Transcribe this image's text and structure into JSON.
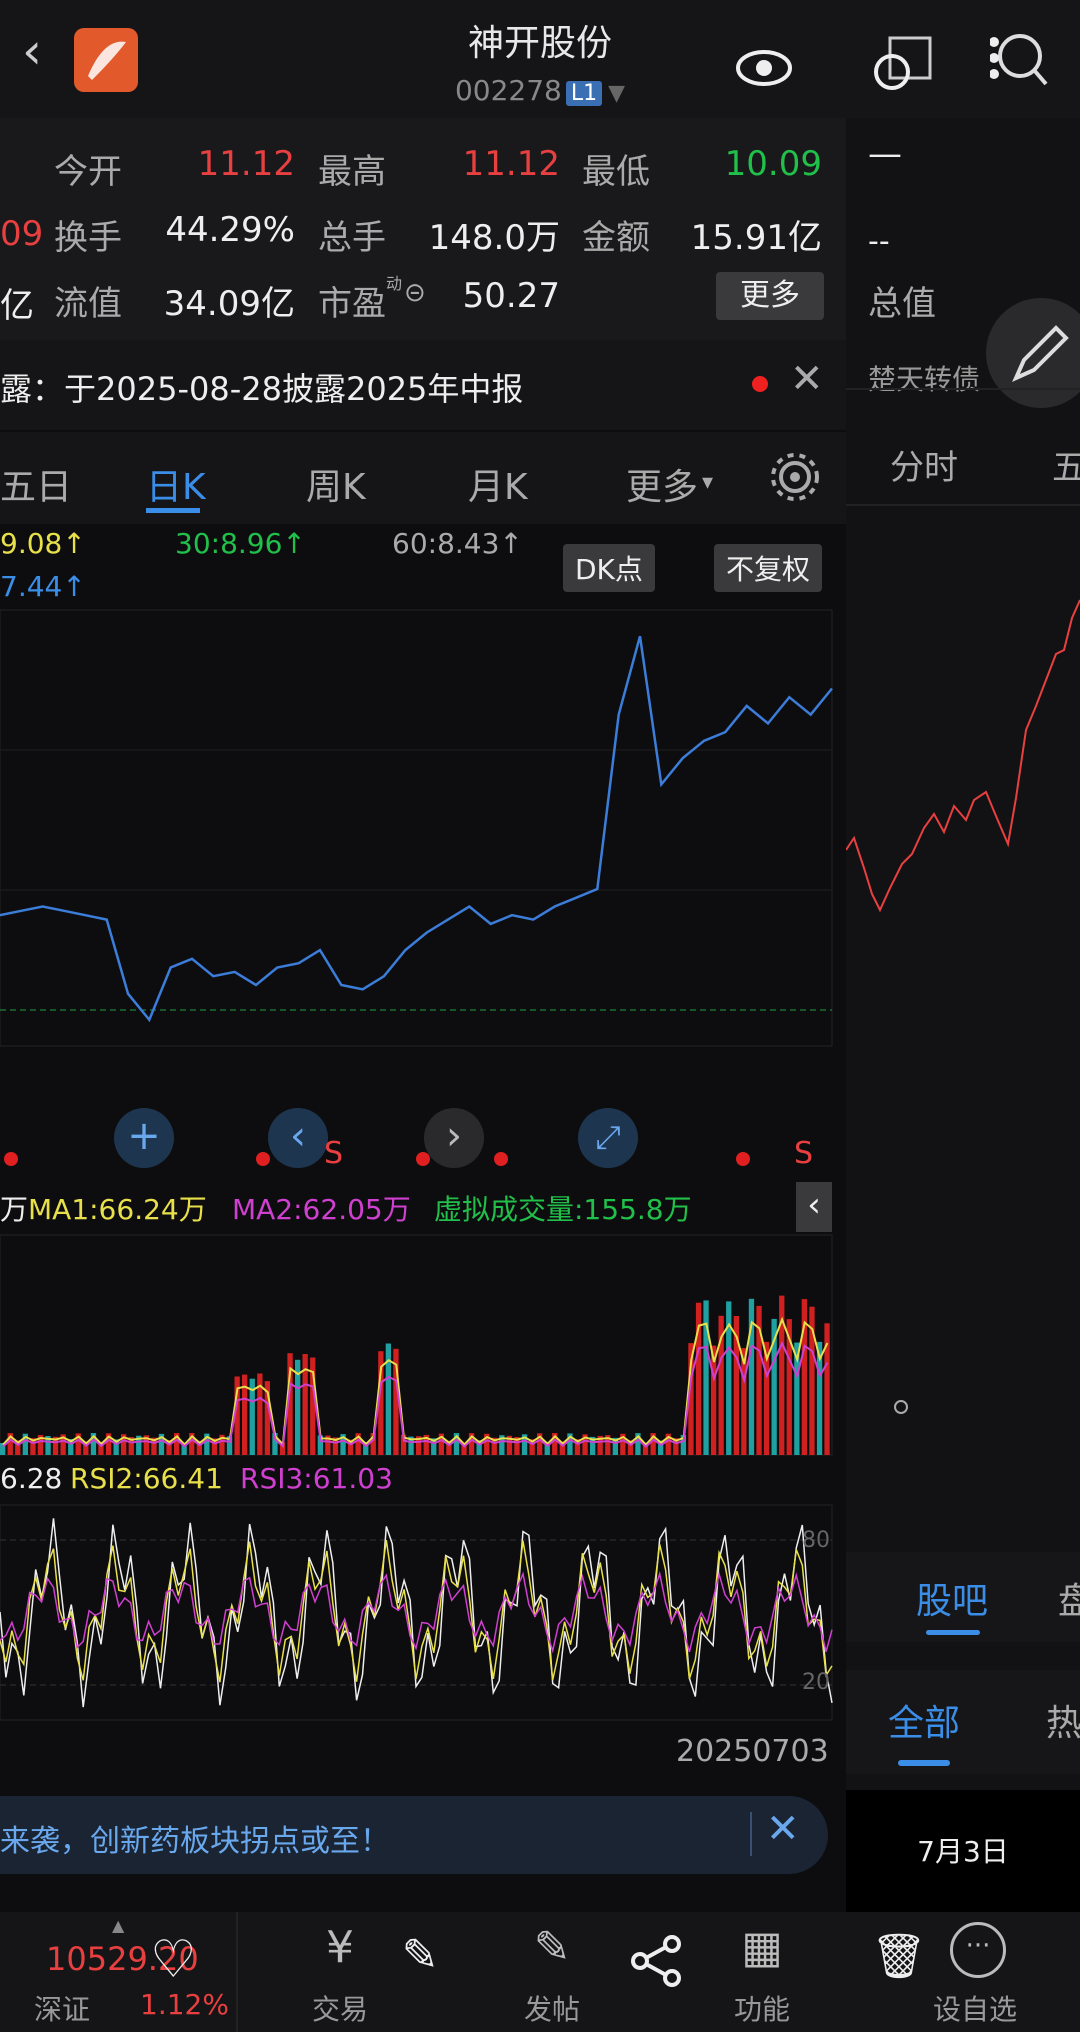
{
  "header": {
    "title": "神开股份",
    "code": "002278",
    "level": "L1"
  },
  "stats": {
    "row1": [
      {
        "label": "今开",
        "value": "11.12"
      },
      {
        "label": "最高",
        "value": "11.12"
      },
      {
        "label": "最低",
        "value": "10.09"
      }
    ],
    "row2": [
      {
        "label": "换手",
        "value": "44.29%"
      },
      {
        "label": "总手",
        "value": "148.0万"
      },
      {
        "label": "金额",
        "value": "15.91亿"
      }
    ],
    "row3": [
      {
        "label": "流值",
        "value": "34.09亿"
      },
      {
        "label": "市盈",
        "value": "50.27"
      }
    ],
    "left_partial_row2": "09",
    "left_partial_row3": "亿",
    "pe_superscript": "动",
    "more_label": "更多"
  },
  "notice": {
    "text": "露：于2025-08-28披露2025年中报"
  },
  "right_panel": {
    "dash1": "—",
    "dash2": "--",
    "total_value_label": "总值",
    "bond_label": "楚天转债",
    "minute_tab": "分时",
    "partial_tab": "五",
    "guba_tab": "股吧",
    "partial_tab2": "盘",
    "all_tab": "全部",
    "hot_tab": "热",
    "date": "7月3日"
  },
  "tabs": {
    "items": [
      "五日",
      "日K",
      "周K",
      "月K",
      "更多"
    ],
    "active": "日K"
  },
  "ma_line": {
    "ma_a": "9.08↑",
    "ma_b": "7.44↑",
    "ma30": "30:8.96↑",
    "ma60": "60:8.43↑",
    "dk_label": "DK点",
    "fq_label": "不复权"
  },
  "volume": {
    "partial": "万",
    "ma1": "MA1:66.24万",
    "ma2": "MA2:62.05万",
    "virtual": "虚拟成交量:155.8万"
  },
  "rsi": {
    "rsi1": "6.28",
    "rsi2": "RSI2:66.41",
    "rsi3": "RSI3:61.03",
    "level80": "80",
    "level20": "20"
  },
  "markers": {
    "s_label": "S"
  },
  "date_label": "20250703",
  "banner": {
    "text": "来袭，创新药板块拐点或至！"
  },
  "footer": {
    "index_value": "10529.20",
    "index_name": "深证",
    "index_change": "1.12%",
    "items": [
      "交易",
      "发帖",
      "功能",
      "设自选"
    ]
  },
  "colors": {
    "up_red": "#e84040",
    "down_green": "#21c04a",
    "accent_blue": "#3b8ee8",
    "ma_yellow": "#e8e04a",
    "ma_magenta": "#d040d0"
  },
  "chart_data": {
    "type": "line",
    "series": [
      {
        "name": "price",
        "values": [
          8.5,
          8.55,
          8.6,
          8.55,
          8.5,
          8.45,
          7.6,
          7.3,
          7.9,
          8.0,
          7.8,
          7.85,
          7.7,
          7.9,
          7.95,
          8.1,
          7.7,
          7.65,
          7.8,
          8.1,
          8.3,
          8.45,
          8.6,
          8.4,
          8.5,
          8.45,
          8.6,
          8.7,
          8.8,
          10.8,
          11.7,
          10.0,
          10.3,
          10.5,
          10.6,
          10.9,
          10.7,
          11.0,
          10.8,
          11.1
        ]
      }
    ]
  }
}
